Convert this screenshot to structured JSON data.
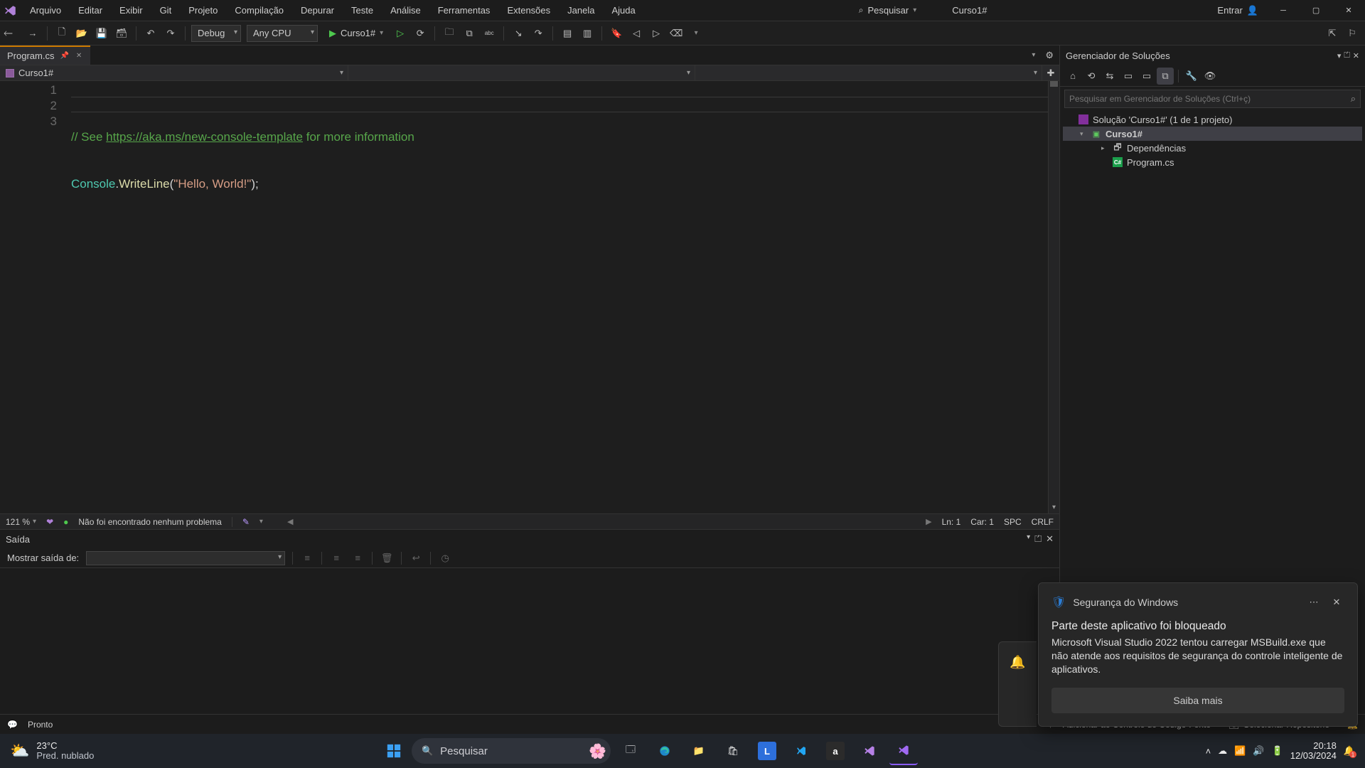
{
  "menu": [
    "Arquivo",
    "Editar",
    "Exibir",
    "Git",
    "Projeto",
    "Compilação",
    "Depurar",
    "Teste",
    "Análise",
    "Ferramentas",
    "Extensões",
    "Janela",
    "Ajuda"
  ],
  "search_placeholder": "Pesquisar",
  "window_name": "Curso1#",
  "signin": "Entrar",
  "toolbar": {
    "config": "Debug",
    "platform": "Any CPU",
    "run_label": "Curso1#"
  },
  "tab": {
    "name": "Program.cs"
  },
  "breadcrumb": {
    "project": "Curso1#"
  },
  "code": {
    "comment_prefix": "// See ",
    "link": "https://aka.ms/new-console-template",
    "comment_suffix": " for more information",
    "type": "Console",
    "method": "WriteLine",
    "string": "\"Hello, World!\""
  },
  "edstatus": {
    "zoom": "121 %",
    "issues": "Não foi encontrado nenhum problema",
    "ln": "Ln: 1",
    "car": "Car: 1",
    "spc": "SPC",
    "eol": "CRLF"
  },
  "output": {
    "title": "Saída",
    "show_from": "Mostrar saída de:"
  },
  "explorer": {
    "title": "Gerenciador de Soluções",
    "search_placeholder": "Pesquisar em Gerenciador de Soluções (Ctrl+ç)",
    "solution": "Solução 'Curso1#' (1 de 1 projeto)",
    "project": "Curso1#",
    "deps": "Dependências",
    "file": "Program.cs"
  },
  "vs_status": {
    "ready": "Pronto",
    "add_source": "Adicionar ao Controle do Código-Fonte",
    "select_repo": "Selecionar Repositório"
  },
  "toast": {
    "app": "Segurança do Windows",
    "heading": "Parte deste aplicativo foi bloqueado",
    "body": "Microsoft Visual Studio 2022 tentou carregar MSBuild.exe que não atende aos requisitos de segurança do controle inteligente de aplicativos.",
    "button": "Saiba mais"
  },
  "taskbar": {
    "temp": "23°C",
    "cond": "Pred. nublado",
    "search": "Pesquisar",
    "time": "20:18",
    "date": "12/03/2024",
    "badge": "1"
  }
}
